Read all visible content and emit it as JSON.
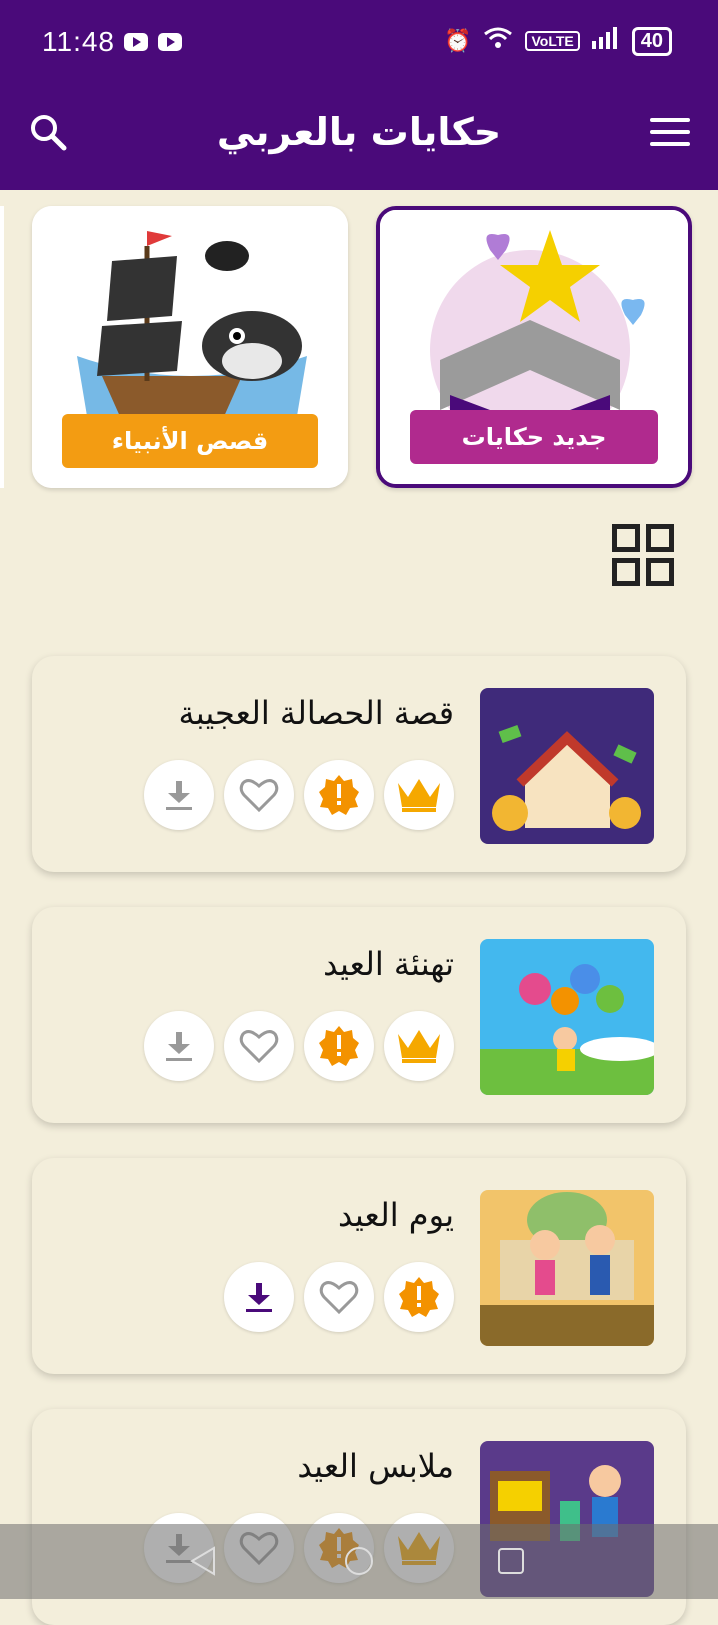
{
  "status": {
    "time": "11:48",
    "volte": "VoLTE",
    "battery": "40"
  },
  "appbar": {
    "title": "حكايات بالعربي"
  },
  "carousel": [
    {
      "caption": "جديد حكايات",
      "selected": true
    },
    {
      "caption": "قصص الأنبياء",
      "selected": false
    }
  ],
  "stories": [
    {
      "title": "قصة الحصالة العجيبة",
      "premium": true,
      "downloaded": false
    },
    {
      "title": "تهنئة العيد",
      "premium": true,
      "downloaded": false
    },
    {
      "title": "يوم العيد",
      "premium": false,
      "downloaded": true
    },
    {
      "title": "ملابس العيد",
      "premium": true,
      "downloaded": false
    }
  ],
  "colors": {
    "primary": "#4a0a7a",
    "background": "#f3eedb",
    "accent": "#f39200",
    "gold": "#f5a800"
  }
}
